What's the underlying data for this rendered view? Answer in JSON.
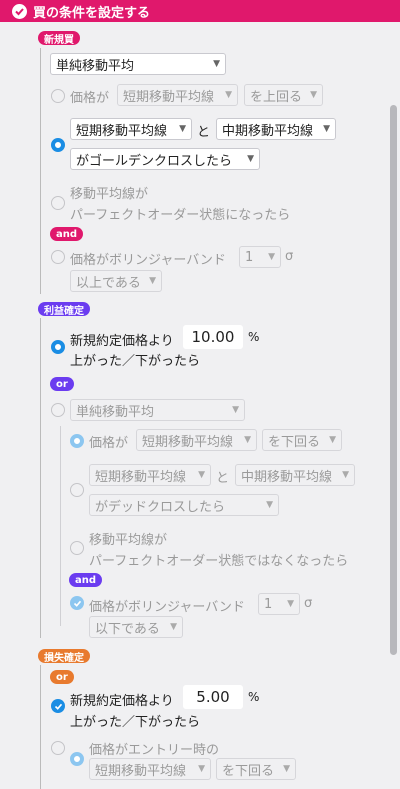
{
  "header": {
    "title": "買の条件を設定する"
  },
  "tags": {
    "new_buy": "新規買",
    "and1": "and",
    "take_profit": "利益確定",
    "or1": "or",
    "and2": "and",
    "stop_loss": "損失確定",
    "or2": "or"
  },
  "entry": {
    "method": "単純移動平均",
    "opt1": {
      "prefix": "価格が",
      "line": "短期移動平均線",
      "cond": "を上回る"
    },
    "opt2": {
      "line_a": "短期移動平均線",
      "and_word": "と",
      "line_b": "中期移動平均線",
      "cond": "がゴールデンクロスしたら"
    },
    "opt3": {
      "line1": "移動平均線が",
      "line2": "パーフェクトオーダー状態になったら"
    },
    "opt4": {
      "prefix": "価格がボリンジャーバンド",
      "sigma_val": "1",
      "sigma": "σ",
      "cond": "以上である"
    }
  },
  "profit": {
    "opt1": {
      "prefix": "新規約定価格より",
      "value": "10.00",
      "unit": "%",
      "suffix": "上がった／下がったら"
    },
    "opt2": {
      "method": "単純移動平均",
      "sub1": {
        "prefix": "価格が",
        "line": "短期移動平均線",
        "cond": "を下回る"
      },
      "sub2": {
        "line_a": "短期移動平均線",
        "and_word": "と",
        "line_b": "中期移動平均線",
        "cond": "がデッドクロスしたら"
      },
      "sub3": {
        "line1": "移動平均線が",
        "line2": "パーフェクトオーダー状態ではなくなったら"
      },
      "sub4": {
        "prefix": "価格がボリンジャーバンド",
        "sigma_val": "1",
        "sigma": "σ",
        "cond": "以下である"
      }
    }
  },
  "loss": {
    "opt1": {
      "prefix": "新規約定価格より",
      "value": "5.00",
      "unit": "%",
      "suffix": "上がった／下がったら"
    },
    "opt2": {
      "label": "価格がエントリー時の",
      "line": "短期移動平均線",
      "cond": "を下回る"
    }
  }
}
